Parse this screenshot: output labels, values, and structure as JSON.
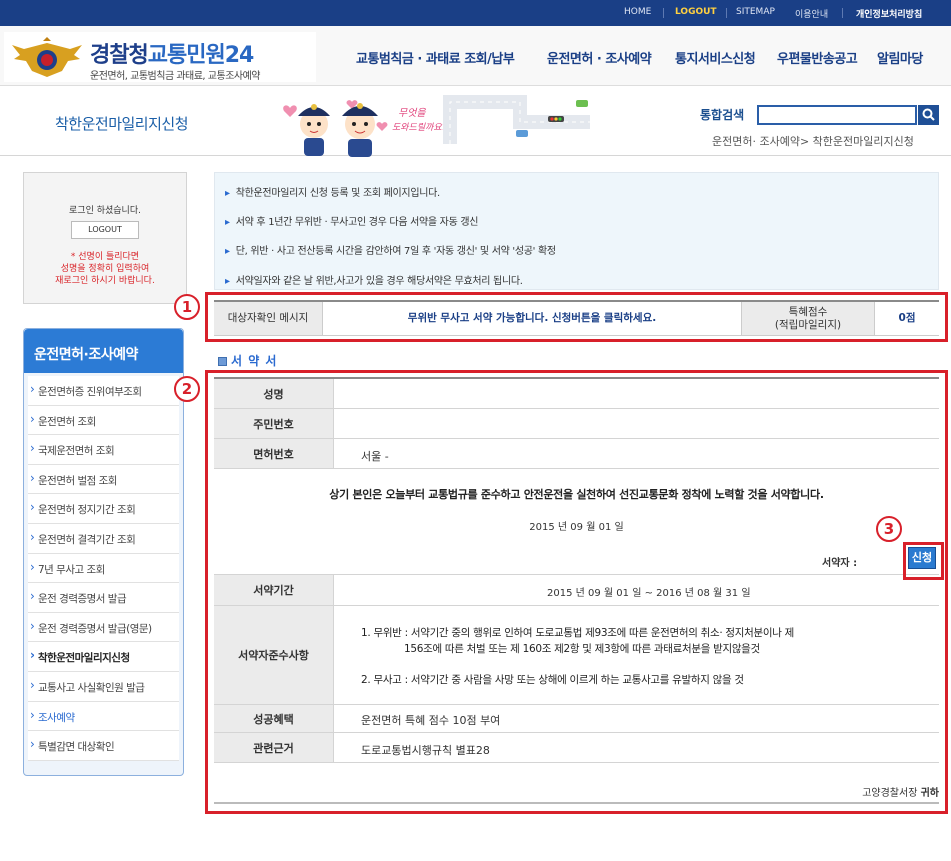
{
  "topbar": {
    "links": [
      "HOME",
      "LOGOUT",
      "SITEMAP",
      "이용안내",
      "개인정보처리방침"
    ]
  },
  "logo": {
    "title_part1": "경찰청",
    "title_part2": "교통민원24",
    "subtitle": "운전면허, 교통범칙금 과태료, 교통조사예약"
  },
  "gnb": [
    "교통범칙금 · 과태료 조회/납부",
    "운전면허 · 조사예약",
    "통지서비스신청",
    "우편물반송공고",
    "알림마당"
  ],
  "subhead": {
    "page_title": "착한운전마일리지신청",
    "mascot_text_1": "무엇을",
    "mascot_text_2": "도와드릴까요?",
    "search_label": "통합검색",
    "search_value": "",
    "breadcrumb": "운전면허· 조사예약> 착한운전마일리지신청"
  },
  "login": {
    "message": "로그인 하셨습니다.",
    "logout_label": "LOGOUT",
    "warning_1": "* 선명이 틀리다면",
    "warning_2": "성명을 정확히 입력하여",
    "warning_3": "재로그인 하시기 바랍니다."
  },
  "lnb": {
    "title": "운전면허·조사예약",
    "items": [
      "운전면허증 진위여부조회",
      "운전면허 조회",
      "국제운전면허 조회",
      "운전면허 벌점 조회",
      "운전면허 정지기간 조회",
      "운전면허 결격기간 조회",
      "7년 무사고 조회",
      "운전 경력증명서 발급",
      "운전 경력증명서 발급(영문)",
      "착한운전마일리지신청",
      "교통사고 사실확인원 발급",
      "조사예약",
      "특별감면 대상확인"
    ]
  },
  "info": {
    "lines": [
      "착한운전마일리지 신청 등록 및 조회 페이지입니다.",
      "서약 후 1년간 무위반 · 무사고인 경우 다음 서약을 자동 갱신",
      "단, 위반 · 사고 전산등록 시간을 감안하여 7일 후 '자동 갱신' 및 서약 '성공' 확정",
      "서약일자와 같은 날 위반,사고가 있을 경우 해당서약은 무효처리 됩니다."
    ]
  },
  "annotations": [
    "1",
    "2",
    "3"
  ],
  "target": {
    "label": "대상자확인 메시지",
    "message": "무위반 무사고 서약 가능합니다. 신청버튼을 클릭하세요.",
    "points_label_1": "특혜점수",
    "points_label_2": "(적립마일리지)",
    "points_value": "0점"
  },
  "pledge": {
    "section_title": "서 약 서",
    "name_label": "성명",
    "name_value": "",
    "rrn_label": "주민번호",
    "rrn_value": "",
    "license_label": "면허번호",
    "license_value": "서울 -",
    "statement": "상기 본인은 오늘부터 교통법규를 준수하고 안전운전을 실천하여 선진교통문화 정착에 노력할 것을 서약합니다.",
    "date": "2015 년 09 월 01 일",
    "signer_label": "서약자 :",
    "apply_label": "신청",
    "period_label": "서약기간",
    "period_value": "2015 년 09 월 01 일 ~ 2016 년 08 월 31 일",
    "rules_label": "서약자준수사항",
    "rule_1a": "1. 무위반 :  서약기간 중의 행위로 인하여 도로교통법 제93조에 따른 운전면허의 취소· 정지처분이나 제",
    "rule_1b": "156조에 따른 처벌 또는 제 160조 제2항 및 제3항에 따른 과태료처분을 받지않을것",
    "rule_2": "2. 무사고 :  서약기간 중 사람을 사망 또는 상해에 이르게 하는 교통사고를 유발하지 않을 것",
    "benefit_label": "성공혜택",
    "benefit_value": "운전면허 특혜 점수 10점 부여",
    "basis_label": "관련근거",
    "basis_value": "도로교통법시행규칙 별표28",
    "footer_office": "고양경찰서장",
    "footer_honor": "귀하"
  }
}
